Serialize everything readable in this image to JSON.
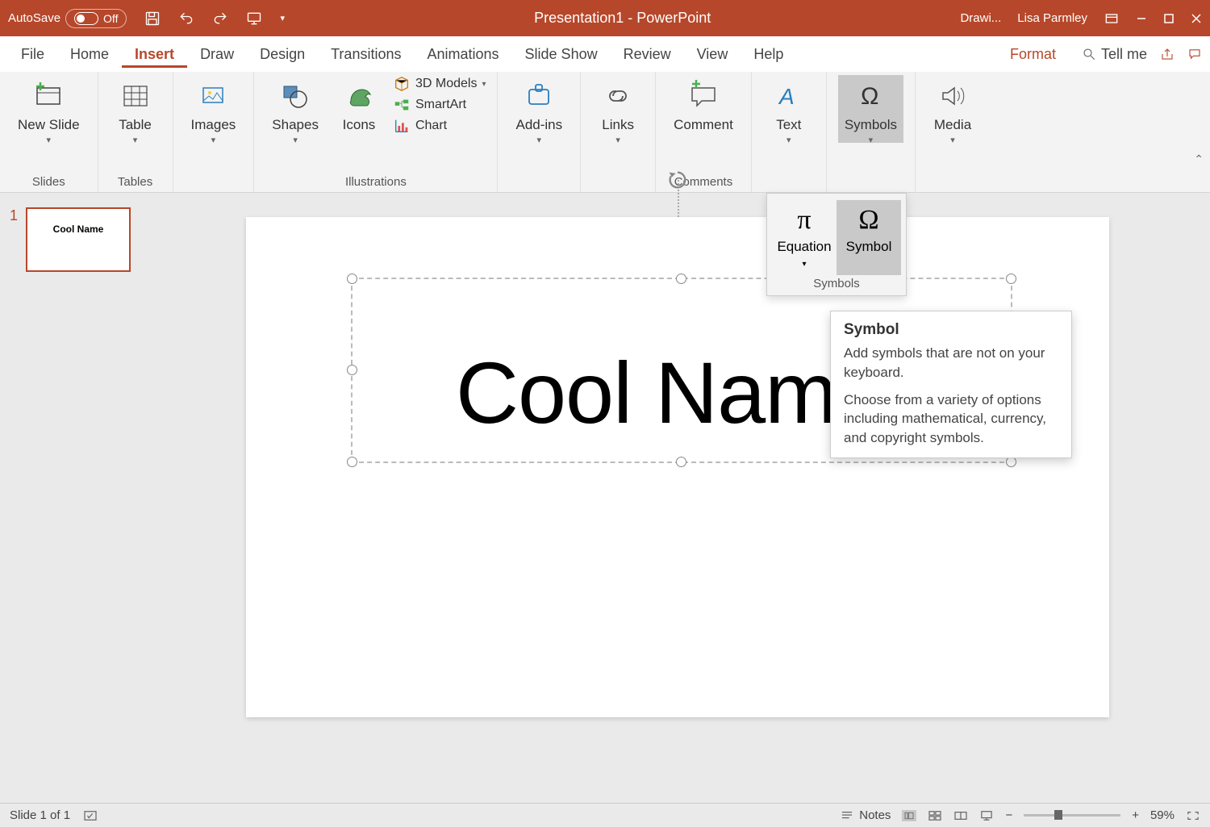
{
  "titlebar": {
    "autosave_label": "AutoSave",
    "autosave_state": "Off",
    "title": "Presentation1  -  PowerPoint",
    "drawing_tools": "Drawi...",
    "user": "Lisa Parmley"
  },
  "menu": {
    "items": [
      "File",
      "Home",
      "Insert",
      "Draw",
      "Design",
      "Transitions",
      "Animations",
      "Slide Show",
      "Review",
      "View",
      "Help"
    ],
    "active": "Insert",
    "format": "Format",
    "tell_me": "Tell me"
  },
  "ribbon": {
    "slides": {
      "new_slide": "New Slide",
      "group": "Slides"
    },
    "tables": {
      "table": "Table",
      "group": "Tables"
    },
    "images": {
      "images": "Images"
    },
    "illustrations": {
      "shapes": "Shapes",
      "icons": "Icons",
      "models": "3D Models",
      "smartart": "SmartArt",
      "chart": "Chart",
      "group": "Illustrations"
    },
    "addins": {
      "addins": "Add-ins"
    },
    "links": {
      "links": "Links"
    },
    "comments": {
      "comment": "Comment",
      "group": "Comments"
    },
    "text": {
      "text": "Text"
    },
    "symbols": {
      "symbols": "Symbols"
    },
    "media": {
      "media": "Media"
    }
  },
  "dropdown": {
    "equation": "Equation",
    "symbol": "Symbol",
    "group": "Symbols"
  },
  "tooltip": {
    "title": "Symbol",
    "p1": "Add symbols that are not on your keyboard.",
    "p2": "Choose from a variety of options including mathematical, currency, and copyright symbols."
  },
  "slide": {
    "number": "1",
    "thumb_text": "Cool Name",
    "title_text": "Cool Name"
  },
  "status": {
    "slide": "Slide 1 of 1",
    "notes": "Notes",
    "zoom": "59%"
  }
}
